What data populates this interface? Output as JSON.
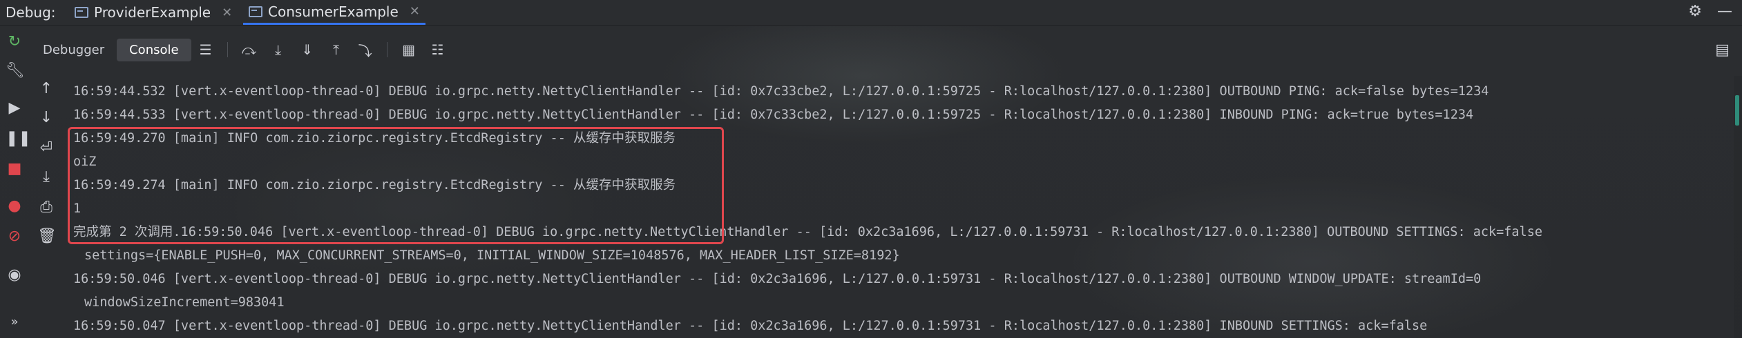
{
  "topbar": {
    "label": "Debug:",
    "tabs": [
      {
        "label": "ProviderExample"
      },
      {
        "label": "ConsumerExample"
      }
    ]
  },
  "toolbar": {
    "tabs": [
      {
        "label": "Debugger"
      },
      {
        "label": "Console"
      }
    ]
  },
  "console": {
    "lines": [
      {
        "text": "16:59:44.532 [vert.x-eventloop-thread-0] DEBUG io.grpc.netty.NettyClientHandler -- [id: 0x7c33cbe2, L:/127.0.0.1:59725 - R:localhost/127.0.0.1:2380] OUTBOUND PING: ack=false bytes=1234"
      },
      {
        "text": "16:59:44.533 [vert.x-eventloop-thread-0] DEBUG io.grpc.netty.NettyClientHandler -- [id: 0x7c33cbe2, L:/127.0.0.1:59725 - R:localhost/127.0.0.1:2380] INBOUND PING: ack=true bytes=1234"
      },
      {
        "text": "16:59:49.270 [main] INFO com.zio.ziorpc.registry.EtcdRegistry -- 从缓存中获取服务"
      },
      {
        "text": "oiZ"
      },
      {
        "text": "16:59:49.274 [main] INFO com.zio.ziorpc.registry.EtcdRegistry -- 从缓存中获取服务"
      },
      {
        "text": "1"
      },
      {
        "text": "完成第 2 次调用.16:59:50.046 [vert.x-eventloop-thread-0] DEBUG io.grpc.netty.NettyClientHandler -- [id: 0x2c3a1696, L:/127.0.0.1:59731 - R:localhost/127.0.0.1:2380] OUTBOUND SETTINGS: ack=false"
      },
      {
        "text": "settings={ENABLE_PUSH=0, MAX_CONCURRENT_STREAMS=0, INITIAL_WINDOW_SIZE=1048576, MAX_HEADER_LIST_SIZE=8192}"
      },
      {
        "text": "16:59:50.046 [vert.x-eventloop-thread-0] DEBUG io.grpc.netty.NettyClientHandler -- [id: 0x2c3a1696, L:/127.0.0.1:59731 - R:localhost/127.0.0.1:2380] OUTBOUND WINDOW_UPDATE: streamId=0"
      },
      {
        "text": "windowSizeIncrement=983041"
      },
      {
        "text": "16:59:50.047 [vert.x-eventloop-thread-0] DEBUG io.grpc.netty.NettyClientHandler -- [id: 0x2c3a1696, L:/127.0.0.1:59731 - R:localhost/127.0.0.1:2380] INBOUND SETTINGS: ack=false"
      }
    ]
  },
  "colors": {
    "background": "#2b2d30",
    "highlight_border": "#e0464d",
    "text": "#bcbec4",
    "active_tab_underline": "#3574f0"
  }
}
